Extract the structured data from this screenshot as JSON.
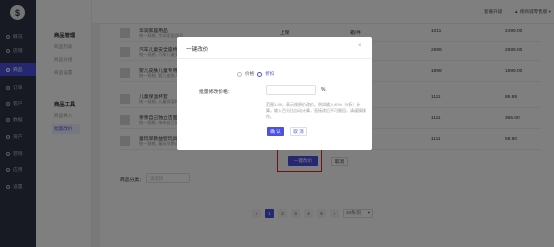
{
  "nav": {
    "logo": "$",
    "items": [
      {
        "label": "概况"
      },
      {
        "label": "店铺"
      },
      {
        "label": "商品"
      },
      {
        "label": "订单"
      },
      {
        "label": "客户"
      },
      {
        "label": "数据"
      },
      {
        "label": "资产"
      },
      {
        "label": "营销"
      },
      {
        "label": "应用"
      },
      {
        "label": "设置"
      }
    ]
  },
  "subnav": {
    "group1_title": "商品管理",
    "group1_items": [
      "商品列表",
      "商品分组",
      "商品设置"
    ],
    "group2_title": "商品工具",
    "group2_items": [
      "商品导入",
      "批量改价"
    ]
  },
  "header": {
    "shop_name": "德商城零售版",
    "upgrade": "套餐升级",
    "user": "▲ 德商城零售版 ▾"
  },
  "table": {
    "rows": [
      {
        "name": "华润家居用品",
        "sub": "统一规格, 华润家居用品",
        "spec": "上架",
        "unit": "箱/件",
        "code": "1011",
        "price": "2499.00"
      },
      {
        "name": "汽车儿童安全座椅",
        "sub": "统一规格, 汽车儿童安全座椅",
        "spec": "",
        "unit": "",
        "code": "2699",
        "price": "2699.00"
      },
      {
        "name": "婴儿皮肤儿童专用霜",
        "sub": "统一规格, 婴儿皮肤儿童专用霜",
        "spec": "",
        "unit": "",
        "code": "1899",
        "price": "1899.00"
      },
      {
        "name": "儿童保温杯套",
        "sub": "统一规格, 儿童保温杯套",
        "spec": "",
        "unit": "",
        "code": "1111",
        "price": "89.88"
      },
      {
        "name": "亲亲自己独立洁面",
        "sub": "统一规格, 亲亲自己独立洁面",
        "spec": "",
        "unit": "",
        "code": "1111",
        "price": "365.00"
      },
      {
        "name": "童玩早教益智玩具",
        "sub": "统一规格, 童玩早教益智玩具",
        "spec": "",
        "unit": "",
        "code": "1111",
        "price": "59.90"
      }
    ]
  },
  "category": {
    "label": "商品分类：",
    "placeholder": "请选择"
  },
  "actions": {
    "bulk_label": "一键改价",
    "cancel_label": "取消"
  },
  "pagination": {
    "prev": "‹",
    "pages": [
      "1",
      "2",
      "3",
      "4",
      "5"
    ],
    "next": "›",
    "page_size": "20条/页"
  },
  "modal": {
    "title": "一键改价",
    "close": "×",
    "option_price": "价格",
    "option_percent": "折扣",
    "field_label": "批量修改价格：",
    "unit": "%",
    "hint": "范围1-99，表示按原价改价。例如输入90%（9折）计算。输入百分比自动计算，直接改后不可撤回，请谨慎操作。",
    "ok": "确 认",
    "cancel": "取 消"
  },
  "colors": {
    "accent": "#4b51e0",
    "nav_bg": "#2f3447",
    "highlight": "#e02020"
  }
}
